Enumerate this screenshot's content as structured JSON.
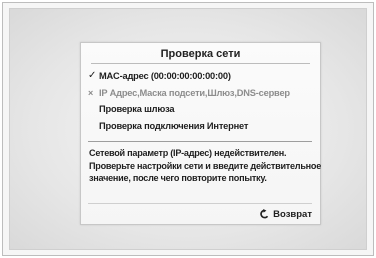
{
  "dialog": {
    "title": "Проверка сети",
    "checks": [
      {
        "status": "ok",
        "mark": "✓",
        "label": "MAC-адрес (00:00:00:00:00:00)"
      },
      {
        "status": "failed",
        "mark": "×",
        "label": "IP Адрес,Маска подсети,Шлюз,DNS-сервер"
      },
      {
        "status": "pending",
        "mark": "",
        "label": "Проверка шлюза"
      },
      {
        "status": "pending",
        "mark": "",
        "label": "Проверка подключения Интернет"
      }
    ],
    "message": {
      "line1": "Сетевой параметр (IP-адрес) недействителен.",
      "line2": "Проверьте настройки сети и введите действительное",
      "line3": "значение, после чего повторите попытку."
    },
    "return_label": "Возврат",
    "return_icon": "return-arrow-icon"
  },
  "colors": {
    "background": "#f6f6f6",
    "dialog_background": "#fbfbfb",
    "text": "#1f1f1f",
    "failed_text": "#8d8d8d"
  }
}
